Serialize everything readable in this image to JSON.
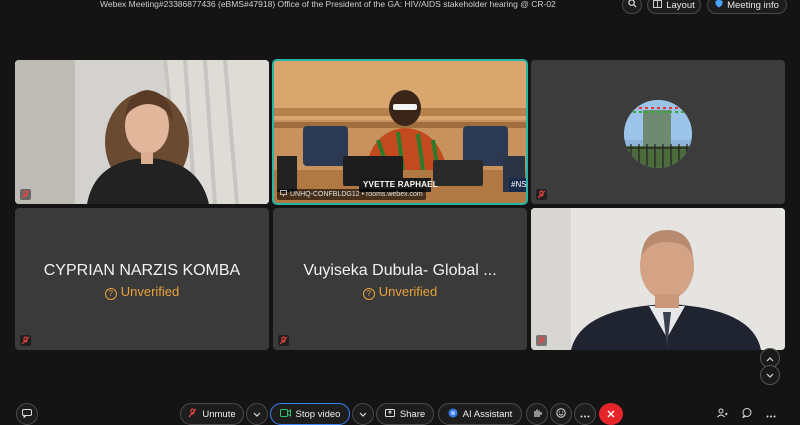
{
  "header": {
    "meeting_title": "Webex Meeting#23386877436 (eBMS#47918) Office of the President of the GA: HIV/AIDS stakeholder hearing @ CR-02",
    "layout_label": "Layout",
    "meeting_info_label": "Meeting info"
  },
  "tiles": {
    "tile1": {
      "name": ""
    },
    "tile2": {
      "room_label": "UNHQ-CONFBLDG12 • rooms.webex.com",
      "nameplate": "YVETTE RAPHAEL",
      "hashtag": "#NS"
    },
    "tile3": {
      "name": ""
    },
    "tile4": {
      "name": "CYPRIAN NARZIS KOMBA",
      "status": "Unverified"
    },
    "tile5": {
      "name": "Vuyiseka Dubula- Global ...",
      "status": "Unverified"
    },
    "tile6": {
      "name": ""
    }
  },
  "toolbar": {
    "unmute_label": "Unmute",
    "stop_video_label": "Stop video",
    "share_label": "Share",
    "ai_assistant_label": "AI Assistant"
  },
  "colors": {
    "background": "#141414",
    "tile_bg": "#3a3a3a",
    "active_speaker": "#28b5a7",
    "unverified": "#e6a23c",
    "end_call": "#e5252a"
  }
}
